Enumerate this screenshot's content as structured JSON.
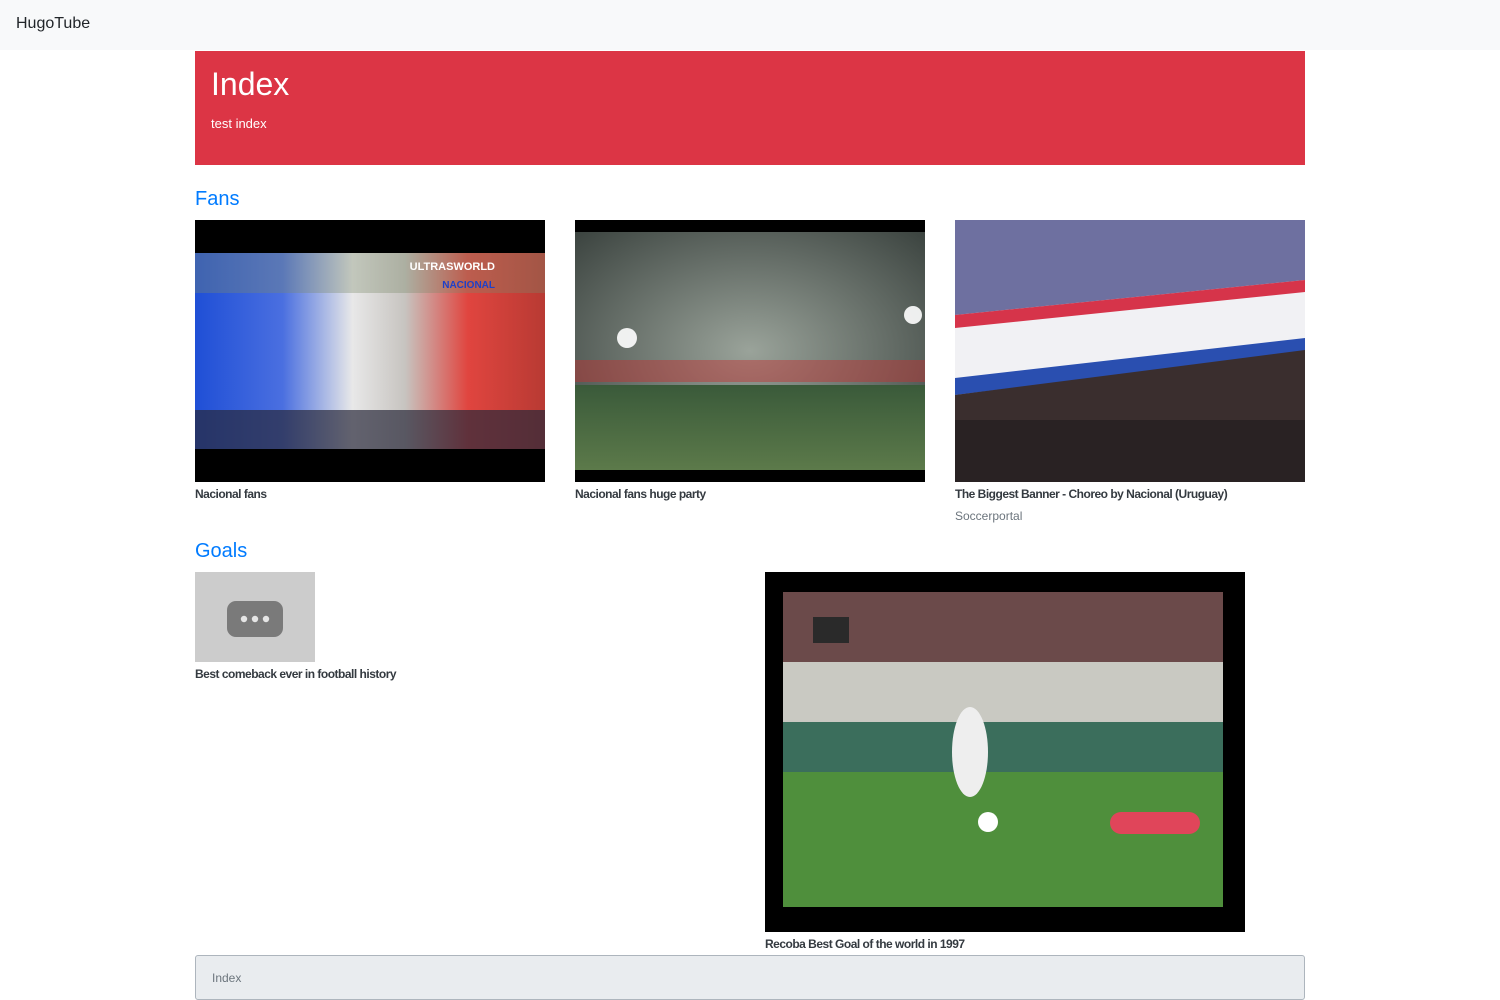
{
  "navbar": {
    "brand": "HugoTube"
  },
  "hero": {
    "title": "Index",
    "description": "test index"
  },
  "sections": [
    {
      "title": "Fans",
      "videos": [
        {
          "title": "Nacional fans",
          "author": ""
        },
        {
          "title": "Nacional fans huge party",
          "author": ""
        },
        {
          "title": "The Biggest Banner - Choreo by Nacional (Uruguay)",
          "author": "Soccerportal"
        }
      ]
    },
    {
      "title": "Goals",
      "videos": [
        {
          "title": "Best comeback ever in football history",
          "author": ""
        },
        {
          "title": "Recoba Best Goal of the world in 1997",
          "author": ""
        }
      ]
    }
  ],
  "footer": {
    "breadcrumb": "Index"
  },
  "colors": {
    "hero_bg": "#dc3545",
    "section_title": "#007bff",
    "navbar_bg": "#f8f9fa"
  }
}
